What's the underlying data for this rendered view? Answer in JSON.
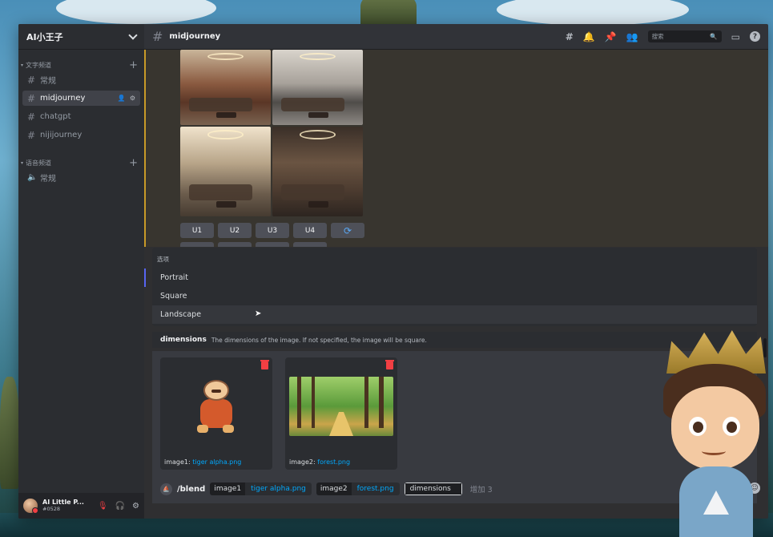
{
  "sidebar": {
    "server_name": "AI小王子",
    "categories": [
      {
        "label": "文字频道",
        "channels": [
          "常规",
          "midjourney",
          "chatgpt",
          "nijijourney"
        ]
      },
      {
        "label": "语音频道",
        "channels": [
          "常规"
        ]
      }
    ],
    "active_channel": "midjourney"
  },
  "user": {
    "name": "AI Little P...",
    "tag": "#0528"
  },
  "topbar": {
    "channel": "midjourney",
    "search_placeholder": "搜索"
  },
  "message": {
    "buttons": [
      "U1",
      "U2",
      "U3",
      "U4"
    ],
    "reroll_icon": "reroll-icon"
  },
  "options_popup": {
    "title": "选项",
    "options": [
      "Portrait",
      "Square",
      "Landscape"
    ]
  },
  "param_hint": {
    "name": "dimensions",
    "description": "The dimensions of the image. If not specified, the image will be square."
  },
  "attachments": [
    {
      "key": "image1:",
      "file": "tiger alpha.png"
    },
    {
      "key": "image2:",
      "file": "forest.png"
    }
  ],
  "command": {
    "name": "/blend",
    "params": [
      {
        "key": "image1",
        "value": "tiger alpha.png"
      },
      {
        "key": "image2",
        "value": "forest.png"
      }
    ],
    "active_param": "dimensions",
    "more": "增加 3"
  },
  "colors": {
    "accent": "#5865f2",
    "link": "#00a8fc",
    "highlight": "#c89a28",
    "danger": "#f23f43"
  }
}
